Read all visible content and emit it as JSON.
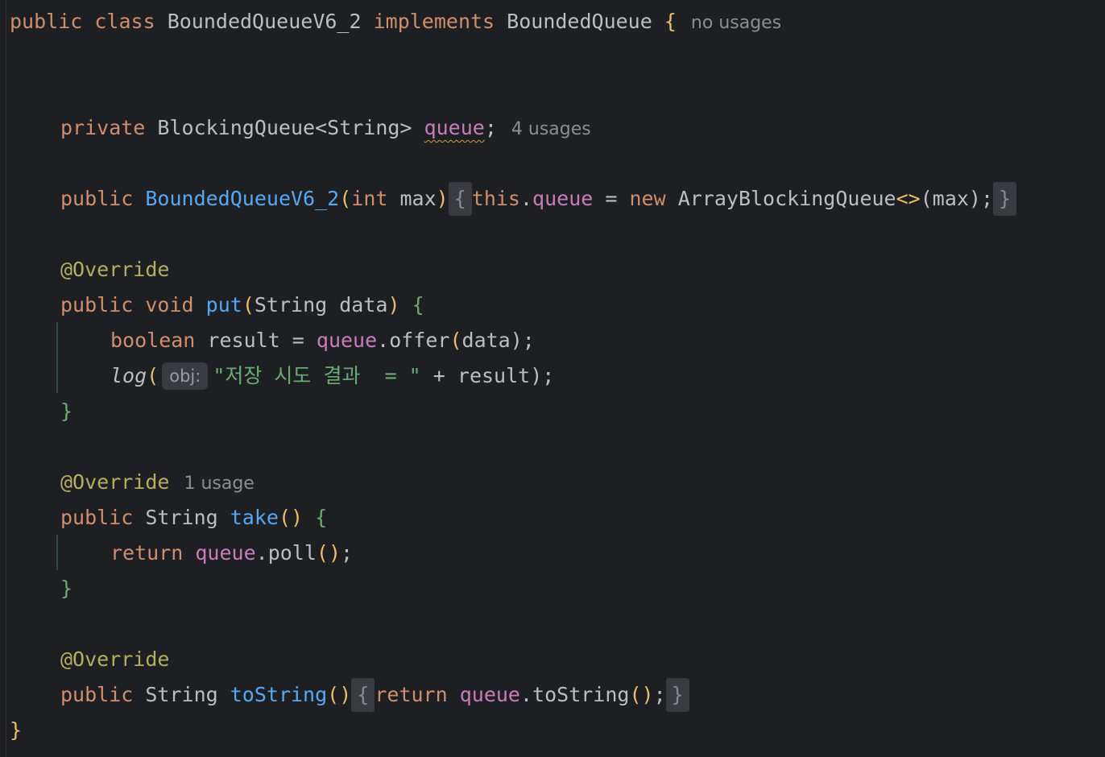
{
  "code": {
    "class_decl": {
      "kw_public": "public",
      "kw_class": "class",
      "class_name": "BoundedQueueV6_2",
      "kw_implements": "implements",
      "interface_name": "BoundedQueue",
      "open_brace": "{",
      "usage_hint": "no usages"
    },
    "field_decl": {
      "kw_private": "private",
      "type": "BlockingQueue<String>",
      "name": "queue",
      "semicolon": ";",
      "usage_hint": "4 usages"
    },
    "constructor": {
      "kw_public": "public",
      "name": "BoundedQueueV6_2",
      "open_paren": "(",
      "kw_int": "int",
      "param": "max",
      "close_paren": ")",
      "fold_open": "{",
      "kw_this": "this",
      "dot": ".",
      "field": "queue",
      "assign": " = ",
      "kw_new": "new",
      "new_type": "ArrayBlockingQueue",
      "diamond": "<>",
      "args": "(max);",
      "fold_close": "}"
    },
    "put_method": {
      "annotation": "@Override",
      "kw_public": "public",
      "kw_void": "void",
      "name": "put",
      "open_paren": "(",
      "param_type": "String",
      "param": "data",
      "close_paren": ")",
      "open_brace": "{",
      "body_line1": {
        "kw_boolean": "boolean",
        "var": "result",
        "assign": " = ",
        "field": "queue",
        "call": ".offer",
        "open": "(",
        "arg": "data",
        "close": ");"
      },
      "body_line2": {
        "fn": "log",
        "open": "(",
        "param_hint": "obj:",
        "string": "\"저장 시도 결과  = \"",
        "concat": " + result",
        "close": ");"
      },
      "close_brace": "}"
    },
    "take_method": {
      "annotation": "@Override",
      "usage_hint": "1 usage",
      "kw_public": "public",
      "return_type": "String",
      "name": "take",
      "parens": "()",
      "open_brace": "{",
      "body": {
        "kw_return": "return",
        "field": "queue",
        "call": ".poll",
        "parens": "()",
        "semicolon": ";"
      },
      "close_brace": "}"
    },
    "tostring_method": {
      "annotation": "@Override",
      "kw_public": "public",
      "return_type": "String",
      "name": "toString",
      "parens": "()",
      "fold_open": "{",
      "kw_return": "return",
      "field": "queue",
      "call": ".toString",
      "call_parens": "()",
      "semicolon": ";",
      "fold_close": "}"
    },
    "class_close_brace": "}"
  },
  "colors": {
    "background": "#1e1f22",
    "keyword": "#cf8e6d",
    "function": "#56a8f5",
    "field": "#c77dbb",
    "annotation": "#b3ae60",
    "string": "#6aab73",
    "text": "#bcbec4",
    "hint": "#8c8e94"
  }
}
